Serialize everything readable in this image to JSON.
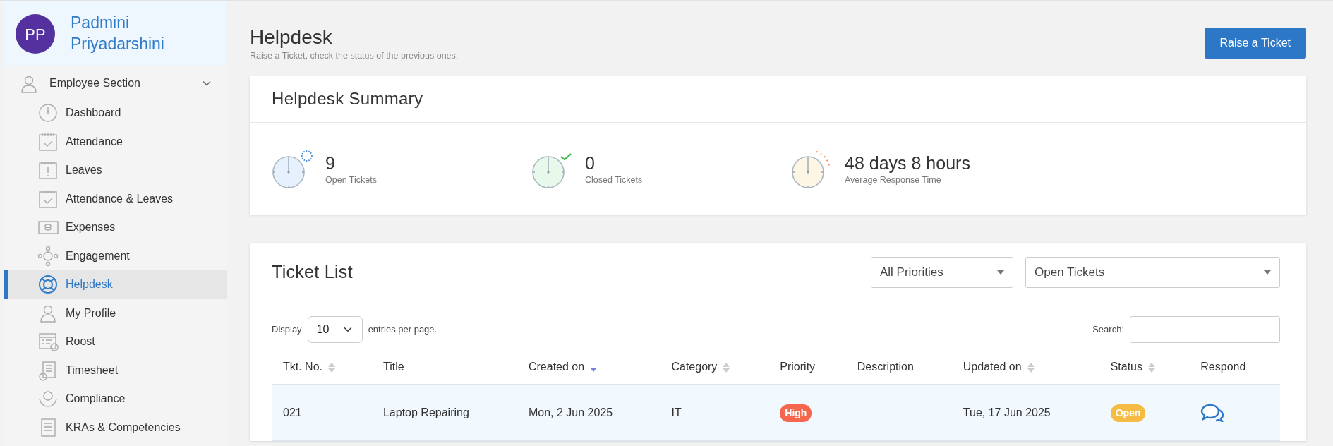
{
  "user": {
    "initials": "PP",
    "name": "Padmini Priyadarshini"
  },
  "sidebar": {
    "section": {
      "label": "Employee Section",
      "expanded": true
    },
    "items": [
      {
        "label": "Dashboard",
        "selected": false
      },
      {
        "label": "Attendance",
        "selected": false
      },
      {
        "label": "Leaves",
        "selected": false
      },
      {
        "label": "Attendance & Leaves",
        "selected": false
      },
      {
        "label": "Expenses",
        "selected": false
      },
      {
        "label": "Engagement",
        "selected": false
      },
      {
        "label": "Helpdesk",
        "selected": true
      },
      {
        "label": "My Profile",
        "selected": false
      },
      {
        "label": "Roost",
        "selected": false
      },
      {
        "label": "Timesheet",
        "selected": false
      },
      {
        "label": "Compliance",
        "selected": false
      },
      {
        "label": "KRAs & Competencies",
        "selected": false
      }
    ]
  },
  "page": {
    "title": "Helpdesk",
    "subtitle": "Raise a Ticket, check the status of the previous ones.",
    "action": "Raise a Ticket"
  },
  "summary": {
    "title": "Helpdesk Summary",
    "stats": [
      {
        "kind": "open",
        "value": "9",
        "label": "Open Tickets"
      },
      {
        "kind": "closed",
        "value": "0",
        "label": "Closed Tickets"
      },
      {
        "kind": "response",
        "value": "48 days 8 hours",
        "label": "Average Response Time"
      }
    ]
  },
  "ticket_list": {
    "title": "Ticket List",
    "priority_filter": "All Priorities",
    "status_filter": "Open Tickets",
    "display_label": "Display",
    "page_size": "10",
    "entries_label": "entries per page.",
    "search_label": "Search:",
    "columns": [
      {
        "label": "Tkt. No.",
        "sortable": true,
        "sorted": false
      },
      {
        "label": "Title",
        "sortable": false,
        "sorted": false
      },
      {
        "label": "Created on",
        "sortable": true,
        "sorted": true
      },
      {
        "label": "Category",
        "sortable": true,
        "sorted": false
      },
      {
        "label": "Priority",
        "sortable": false,
        "sorted": false
      },
      {
        "label": "Description",
        "sortable": false,
        "sorted": false
      },
      {
        "label": "Updated on",
        "sortable": true,
        "sorted": false
      },
      {
        "label": "Status",
        "sortable": true,
        "sorted": false
      },
      {
        "label": "Respond",
        "sortable": false,
        "sorted": false
      }
    ],
    "rows": [
      {
        "number": "021",
        "title": "Laptop Repairing",
        "created": "Mon, 2 Jun 2025",
        "category": "IT",
        "priority": {
          "text": "High",
          "color": "#f4674e"
        },
        "updated": "Tue, 17 Jun 2025",
        "status": {
          "text": "Open",
          "color": "#f6bb42"
        }
      }
    ]
  }
}
